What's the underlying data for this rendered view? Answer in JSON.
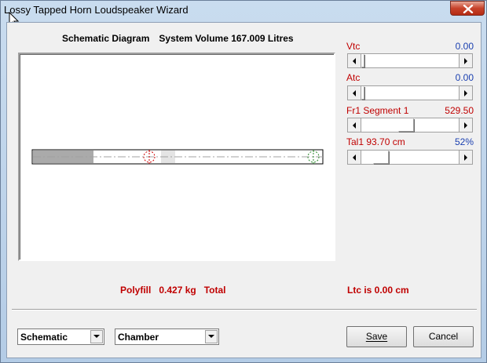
{
  "window": {
    "title": "Lossy Tapped Horn Loudspeaker Wizard"
  },
  "schematic": {
    "heading": "Schematic Diagram",
    "volume_text": "System Volume 167.009 Litres"
  },
  "controls": {
    "vtc": {
      "label": "Vtc",
      "value": "0.00",
      "position": 0.0
    },
    "atc": {
      "label": "Atc",
      "value": "0.00",
      "position": 0.0
    },
    "fr1": {
      "label": "Fr1  Segment 1",
      "value": "529.50",
      "position": 0.5
    },
    "tal1": {
      "label": "Tal1  93.70 cm",
      "value": "52%",
      "position": 0.2
    }
  },
  "status": {
    "polyfill": "Polyfill   0.427 kg   Total",
    "ltc": "Ltc is 0.00 cm"
  },
  "footer": {
    "view_select": "Schematic",
    "section_select": "Chamber",
    "save_label": "Save",
    "cancel_label": "Cancel"
  },
  "colors": {
    "label_red": "#c00000",
    "value_blue": "#1a3fb0",
    "duct_fill": "#aaaaaa",
    "marker_red": "#cc0000",
    "marker_green": "#2a8a2a"
  },
  "icons": {
    "close": "close-icon",
    "cursor": "mouse-cursor-icon",
    "scroll_left": "left-arrow-icon",
    "scroll_right": "right-arrow-icon",
    "dropdown": "chevron-down-icon"
  }
}
